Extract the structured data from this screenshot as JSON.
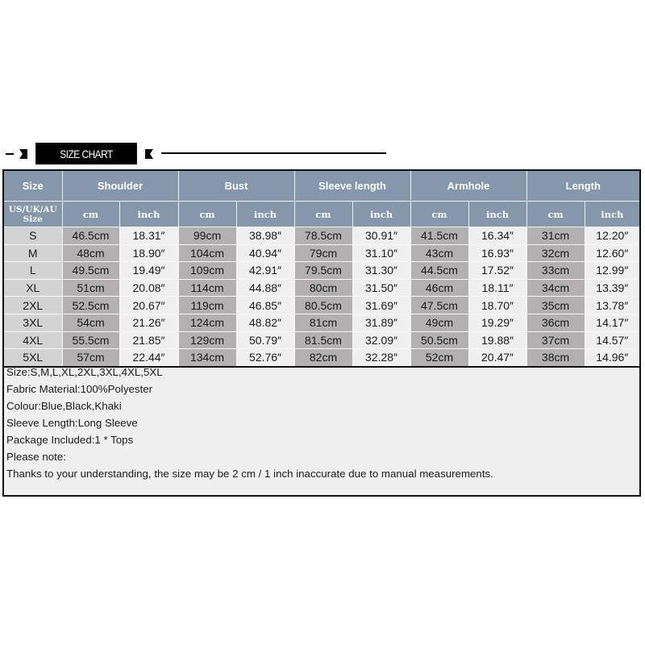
{
  "banner": {
    "title": "SIZE CHART"
  },
  "table": {
    "header": {
      "size": "Size",
      "groups": [
        "Shoulder",
        "Bust",
        "Sleeve length",
        "Armhole",
        "Length"
      ]
    },
    "subheader": {
      "size_line1": "US/UK/AU",
      "size_line2": "Size",
      "cm": "cm",
      "inch": "inch"
    },
    "rows": [
      {
        "size": "S",
        "shoulder_cm": "46.5cm",
        "shoulder_in": "18.31″",
        "bust_cm": "99cm",
        "bust_in": "38.98″",
        "sleeve_cm": "78.5cm",
        "sleeve_in": "30.91″",
        "armhole_cm": "41.5cm",
        "armhole_in": "16.34″",
        "length_cm": "31cm",
        "length_in": "12.20″"
      },
      {
        "size": "M",
        "shoulder_cm": "48cm",
        "shoulder_in": "18.90″",
        "bust_cm": "104cm",
        "bust_in": "40.94″",
        "sleeve_cm": "79cm",
        "sleeve_in": "31.10″",
        "armhole_cm": "43cm",
        "armhole_in": "16.93″",
        "length_cm": "32cm",
        "length_in": "12.60″"
      },
      {
        "size": "L",
        "shoulder_cm": "49.5cm",
        "shoulder_in": "19.49″",
        "bust_cm": "109cm",
        "bust_in": "42.91″",
        "sleeve_cm": "79.5cm",
        "sleeve_in": "31.30″",
        "armhole_cm": "44.5cm",
        "armhole_in": "17.52″",
        "length_cm": "33cm",
        "length_in": "12.99″"
      },
      {
        "size": "XL",
        "shoulder_cm": "51cm",
        "shoulder_in": "20.08″",
        "bust_cm": "114cm",
        "bust_in": "44.88″",
        "sleeve_cm": "80cm",
        "sleeve_in": "31.50″",
        "armhole_cm": "46cm",
        "armhole_in": "18.11″",
        "length_cm": "34cm",
        "length_in": "13.39″"
      },
      {
        "size": "2XL",
        "shoulder_cm": "52.5cm",
        "shoulder_in": "20.67″",
        "bust_cm": "119cm",
        "bust_in": "46.85″",
        "sleeve_cm": "80.5cm",
        "sleeve_in": "31.69″",
        "armhole_cm": "47.5cm",
        "armhole_in": "18.70″",
        "length_cm": "35cm",
        "length_in": "13.78″"
      },
      {
        "size": "3XL",
        "shoulder_cm": "54cm",
        "shoulder_in": "21.26″",
        "bust_cm": "124cm",
        "bust_in": "48.82″",
        "sleeve_cm": "81cm",
        "sleeve_in": "31.89″",
        "armhole_cm": "49cm",
        "armhole_in": "19.29″",
        "length_cm": "36cm",
        "length_in": "14.17″"
      },
      {
        "size": "4XL",
        "shoulder_cm": "55.5cm",
        "shoulder_in": "21.85″",
        "bust_cm": "129cm",
        "bust_in": "50.79″",
        "sleeve_cm": "81.5cm",
        "sleeve_in": "32.09″",
        "armhole_cm": "50.5cm",
        "armhole_in": "19.88″",
        "length_cm": "37cm",
        "length_in": "14.57″"
      },
      {
        "size": "5XL",
        "shoulder_cm": "57cm",
        "shoulder_in": "22.44″",
        "bust_cm": "134cm",
        "bust_in": "52.76″",
        "sleeve_cm": "82cm",
        "sleeve_in": "32.28″",
        "armhole_cm": "52cm",
        "armhole_in": "20.47″",
        "length_cm": "38cm",
        "length_in": "14.96″"
      }
    ]
  },
  "notes": [
    "Size:S,M,L,XL,2XL,3XL,4XL,5XL",
    "Fabric Material:100%Polyester",
    "Colour:Blue,Black,Khaki",
    "Sleeve Length:Long Sleeve",
    "Package Included:1 * Tops",
    "Please note:",
    "Thanks to your understanding, the size may be 2 cm / 1 inch inaccurate due to manual measurements."
  ],
  "colors": {
    "header_bg": "#8597ab",
    "size_cell_bg": "#d3d3d3",
    "cm_cell_bg": "#b2b0b0",
    "inch_cell_bg": "#f0f0f0",
    "banner_bg": "#000000"
  }
}
